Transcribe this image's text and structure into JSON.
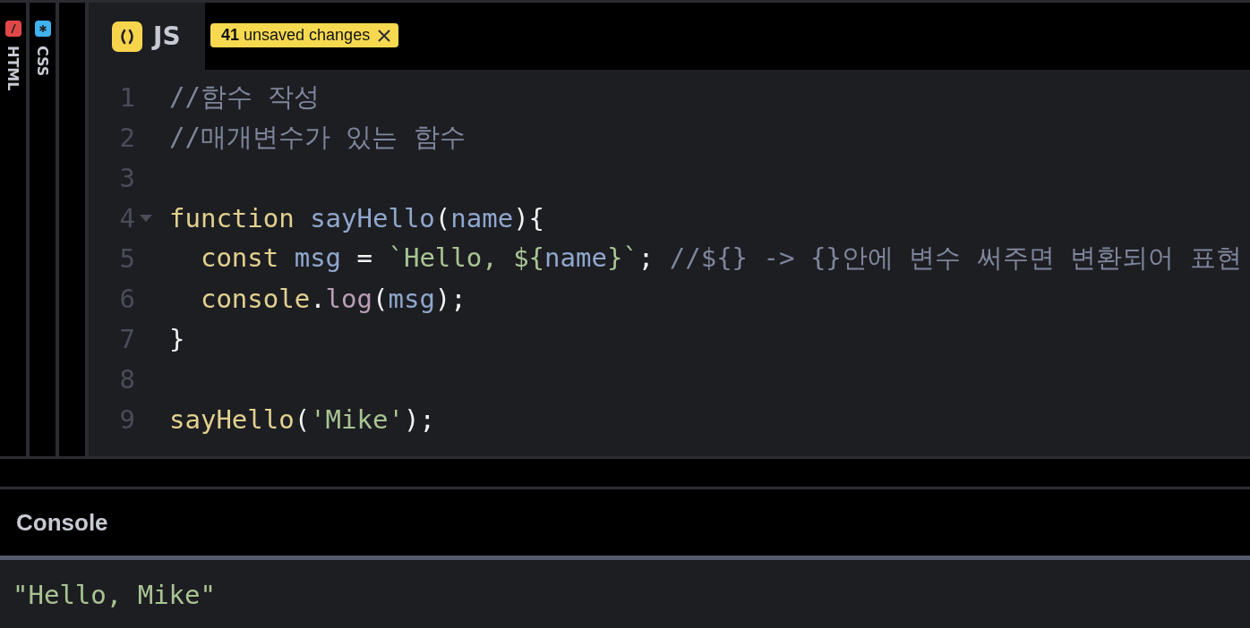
{
  "panes": [
    {
      "label": "HTML",
      "kind": "html",
      "selected": false
    },
    {
      "label": "CSS",
      "kind": "css",
      "selected": false
    },
    {
      "label": "JS",
      "kind": "js",
      "selected": true
    }
  ],
  "unsaved_badge": {
    "text": "**41** unsaved changes"
  },
  "code_lines": [
    {
      "number": "1",
      "tokens": [
        {
          "text": "//함수 작성",
          "kind": "comment"
        }
      ]
    },
    {
      "number": "2",
      "tokens": [
        {
          "text": "//매개변수가 있는 함수",
          "kind": "comment"
        }
      ]
    },
    {
      "number": "3"
    },
    {
      "number": "4",
      "foldable": true,
      "tokens": [
        {
          "text": "function ",
          "kind": "keyword"
        },
        {
          "text": "sayHello",
          "kind": "def"
        },
        {
          "text": "(",
          "kind": "plain"
        },
        {
          "text": "name",
          "kind": "def"
        },
        {
          "text": "){",
          "kind": "plain"
        }
      ]
    },
    {
      "number": "5",
      "tokens": [
        {
          "text": "  const ",
          "kind": "keyword"
        },
        {
          "text": "msg",
          "kind": "def"
        },
        {
          "text": " = ",
          "kind": "plain"
        },
        {
          "text": "`Hello, ${",
          "kind": "string"
        },
        {
          "text": "name",
          "kind": "def"
        },
        {
          "text": "}`",
          "kind": "string"
        },
        {
          "text": "; ",
          "kind": "plain"
        },
        {
          "text": "//${} -> {}안에 변수 써주면 변환되어 표현",
          "kind": "comment"
        }
      ]
    },
    {
      "number": "6",
      "tokens": [
        {
          "text": "  console",
          "kind": "keyword"
        },
        {
          "text": ".",
          "kind": "plain"
        },
        {
          "text": "log",
          "kind": "property"
        },
        {
          "text": "(",
          "kind": "plain"
        },
        {
          "text": "msg",
          "kind": "def"
        },
        {
          "text": ");",
          "kind": "plain"
        }
      ]
    },
    {
      "number": "7",
      "tokens": [
        {
          "text": "}",
          "kind": "plain"
        }
      ]
    },
    {
      "number": "8"
    },
    {
      "number": "9",
      "tokens": [
        {
          "text": "sayHello",
          "kind": "keyword"
        },
        {
          "text": "(",
          "kind": "plain"
        },
        {
          "text": "'Mike'",
          "kind": "string"
        },
        {
          "text": ");",
          "kind": "plain"
        }
      ]
    }
  ],
  "console": {
    "title": "Console",
    "output": [
      {
        "text": "\"Hello, Mike\"",
        "kind": "string"
      }
    ]
  }
}
